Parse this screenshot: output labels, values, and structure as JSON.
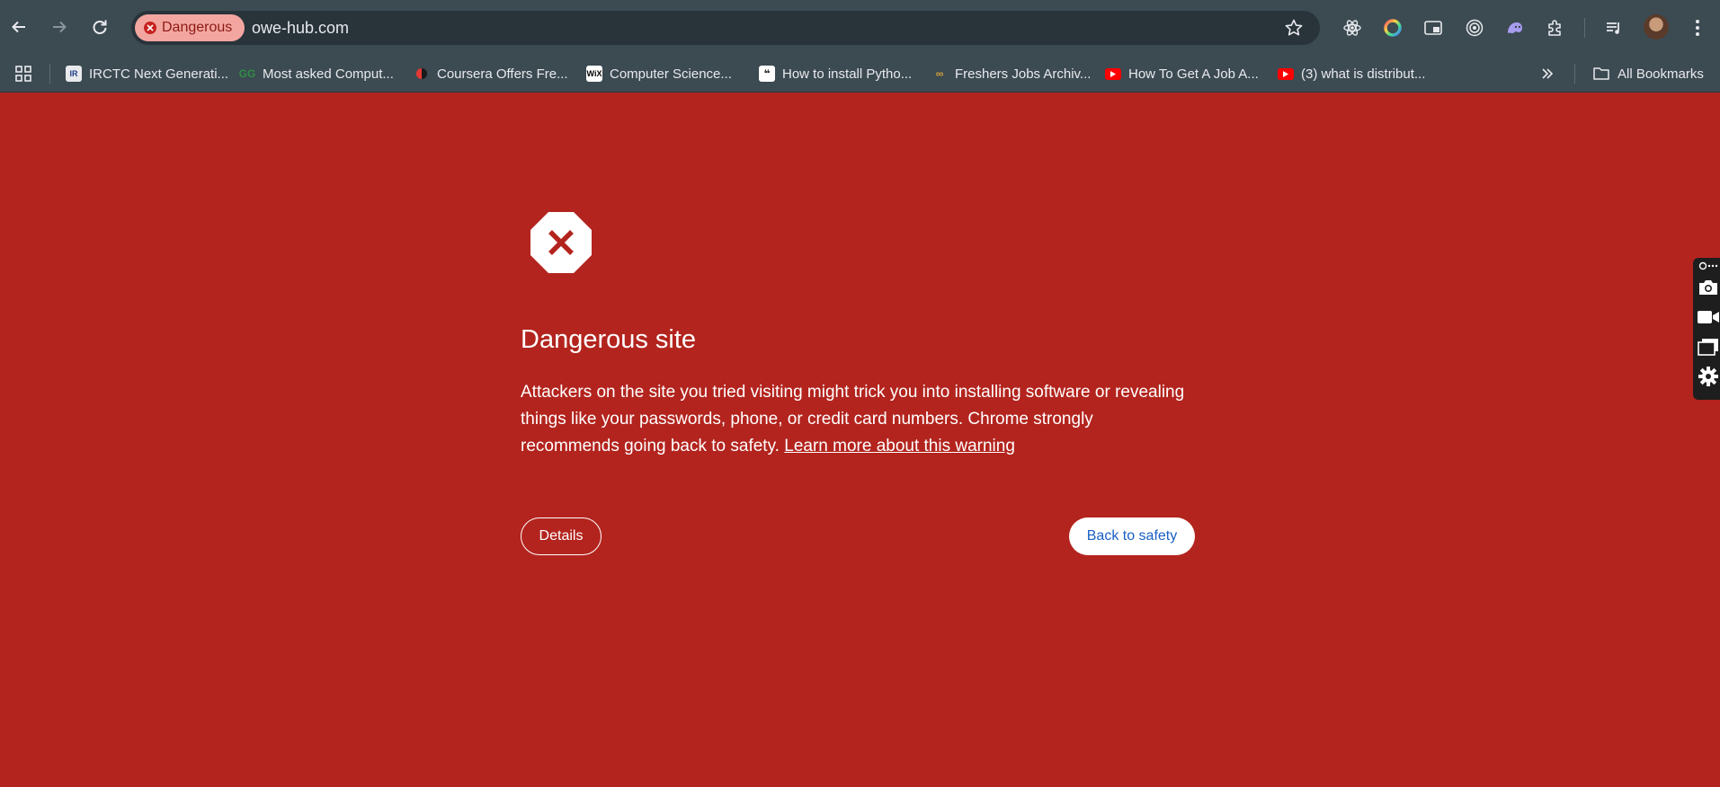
{
  "browser": {
    "chip_label": "Dangerous",
    "url": "owe-hub.com",
    "colors": {
      "toolbar": "#3c4a52",
      "omnibox": "#28333a",
      "danger_chip": "#f3a6a0"
    }
  },
  "bookmarks": {
    "items": [
      {
        "label": "IRCTC Next Generati...",
        "icon": "irctc-favicon"
      },
      {
        "label": "Most asked Comput...",
        "icon": "geeksforgeeks-favicon"
      },
      {
        "label": "Coursera Offers Fre...",
        "icon": "coursera-favicon"
      },
      {
        "label": "Computer Science...",
        "icon": "wix-favicon"
      },
      {
        "label": "How to install Pytho...",
        "icon": "quote-favicon"
      },
      {
        "label": "Freshers Jobs Archiv...",
        "icon": "freshers-favicon"
      },
      {
        "label": "How To Get A Job A...",
        "icon": "youtube-favicon"
      },
      {
        "label": "(3) what is distribut...",
        "icon": "youtube-favicon"
      }
    ],
    "all_bookmarks_label": "All Bookmarks"
  },
  "warning": {
    "heading": "Dangerous site",
    "body": "Attackers on the site you tried visiting might trick you into installing software or revealing things like your passwords, phone, or credit card numbers. Chrome strongly recommends going back to safety.",
    "learn_more": "Learn more about this warning",
    "details_button": "Details",
    "back_button": "Back to safety",
    "background_color": "#b3241e"
  },
  "side_panel": {
    "buttons": [
      "screenshot-icon",
      "camera-icon",
      "video-icon",
      "window-icon",
      "settings-icon"
    ]
  }
}
